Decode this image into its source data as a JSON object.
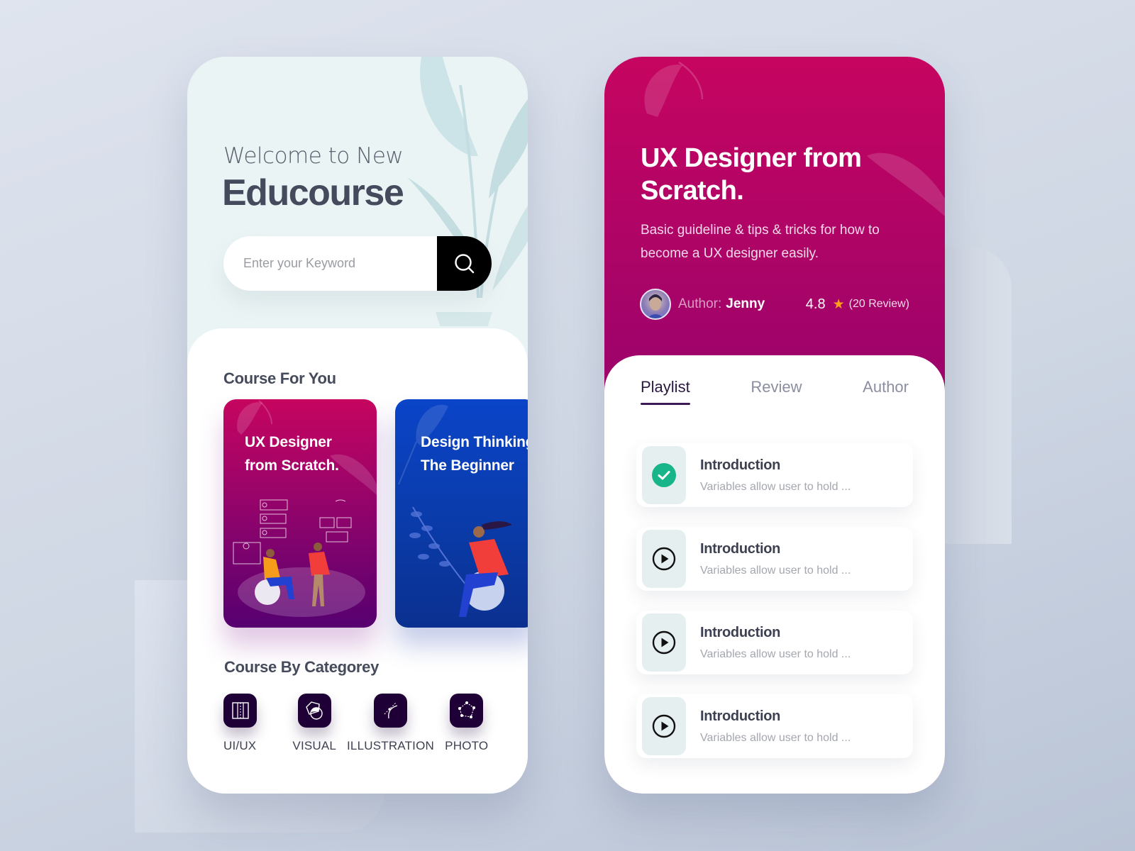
{
  "colors": {
    "primary_magenta": "#c60560",
    "deep_purple": "#560070",
    "blue_card": "#0a44c8",
    "category_icon_bg": "#1e0036",
    "check_green": "#18b58a",
    "star_orange": "#ff9f1a",
    "text_dark": "#454a5c"
  },
  "home": {
    "welcome_text": "Welcome to New",
    "brand_name": "Educourse",
    "search": {
      "placeholder": "Enter your Keyword",
      "value": "",
      "button_icon": "search-icon"
    },
    "course_section_title": "Course For You",
    "courses": [
      {
        "title_line1": "UX Designer",
        "title_line2": "from Scratch.",
        "theme": "magenta"
      },
      {
        "title_line1": "Design Thinking",
        "title_line2": "The Beginner",
        "theme": "blue"
      }
    ],
    "category_section_title": "Course By Categorey",
    "categories": [
      {
        "label": "UI/UX",
        "icon": "layout-grid-icon"
      },
      {
        "label": "VISUAL",
        "icon": "shapes-icon"
      },
      {
        "label": "ILLUSTRATION",
        "icon": "pen-tool-icon"
      },
      {
        "label": "PHOTO",
        "icon": "polygon-nodes-icon"
      }
    ]
  },
  "detail": {
    "title_line1": "UX Designer from",
    "title_line2": "Scratch.",
    "description": "Basic guideline & tips & tricks for how to become a UX designer easily.",
    "author_label": "Author:",
    "author_name": "Jenny",
    "rating": "4.8",
    "review_count": "(20 Review)",
    "tabs": [
      {
        "label": "Playlist",
        "active": true
      },
      {
        "label": "Review",
        "active": false
      },
      {
        "label": "Author",
        "active": false
      }
    ],
    "playlist": [
      {
        "title": "Introduction",
        "subtitle": "Variables allow user to hold  ...",
        "status": "completed"
      },
      {
        "title": "Introduction",
        "subtitle": "Variables allow user to hold  ...",
        "status": "play"
      },
      {
        "title": "Introduction",
        "subtitle": "Variables allow user to hold  ...",
        "status": "play"
      },
      {
        "title": "Introduction",
        "subtitle": "Variables allow user to hold  ...",
        "status": "play"
      }
    ]
  }
}
